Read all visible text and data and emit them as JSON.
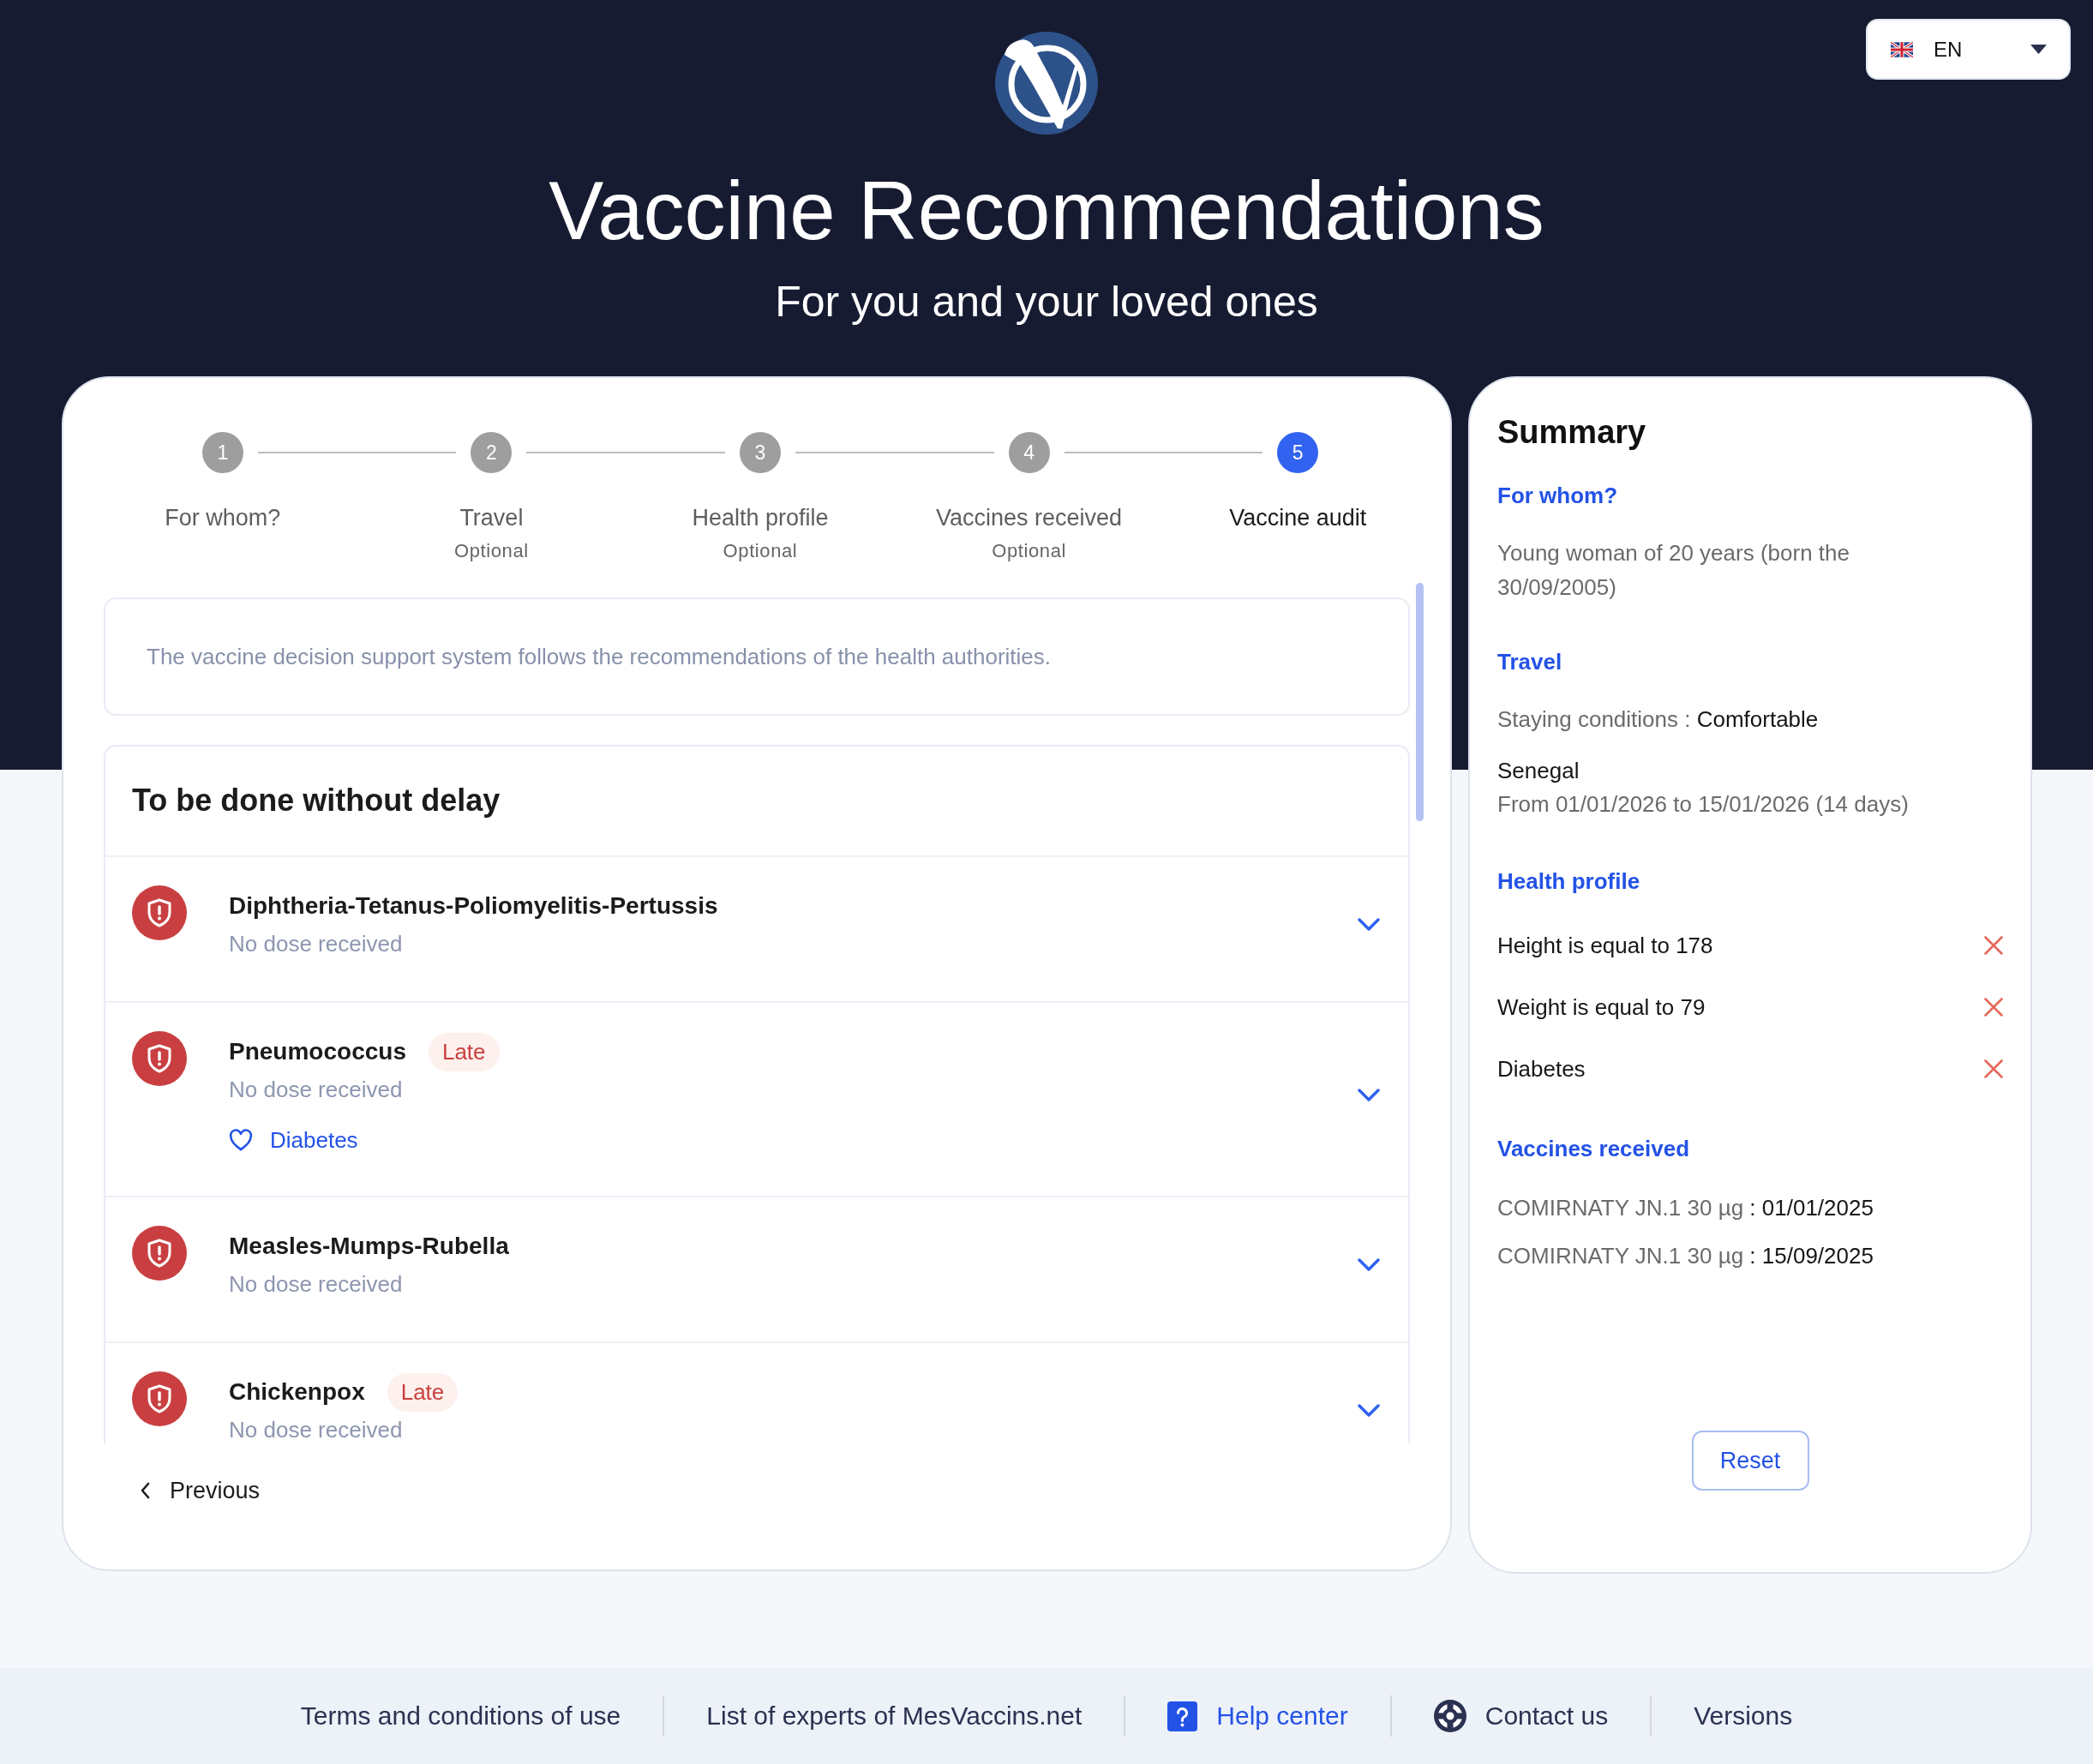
{
  "language_selector": {
    "code": "EN"
  },
  "header": {
    "title": "Vaccine Recommendations",
    "subtitle": "For you and your loved ones"
  },
  "stepper": [
    {
      "number": "1",
      "label": "For whom?",
      "selected": false
    },
    {
      "number": "2",
      "label": "Travel",
      "note": "Optional",
      "selected": false
    },
    {
      "number": "3",
      "label": "Health profile",
      "note": "Optional",
      "selected": false
    },
    {
      "number": "4",
      "label": "Vaccines received",
      "note": "Optional",
      "selected": false
    },
    {
      "number": "5",
      "label": "Vaccine audit",
      "selected": true
    }
  ],
  "notice": "The vaccine decision support system follows the recommendations of the health authorities.",
  "section": {
    "title": "To be done without delay",
    "items": [
      {
        "name": "Diphtheria-Tetanus-Poliomyelitis-Pertussis",
        "status": "No dose received"
      },
      {
        "name": "Pneumococcus",
        "badge": "Late",
        "status": "No dose received",
        "tags": [
          "Diabetes"
        ]
      },
      {
        "name": "Measles-Mumps-Rubella",
        "status": "No dose received"
      },
      {
        "name": "Chickenpox",
        "badge": "Late",
        "status": "No dose received"
      }
    ]
  },
  "previous_button": "Previous",
  "summary": {
    "title": "Summary",
    "for_whom": {
      "heading": "For whom?",
      "text": "Young woman of 20 years (born the 30/09/2005)"
    },
    "travel": {
      "heading": "Travel",
      "staying_label": "Staying conditions :",
      "staying_value": "Comfortable",
      "destination": "Senegal",
      "dates": "From 01/01/2026 to 15/01/2026 (14 days)"
    },
    "health_profile": {
      "heading": "Health profile",
      "items": [
        "Height is equal to 178",
        "Weight is equal to 79",
        "Diabetes"
      ]
    },
    "vaccines_received": {
      "heading": "Vaccines received",
      "items": [
        {
          "vaccine": "COMIRNATY JN.1 30 µg",
          "date": ": 01/01/2025"
        },
        {
          "vaccine": "COMIRNATY JN.1 30 µg",
          "date": ": 15/09/2025"
        }
      ]
    },
    "reset_button": "Reset"
  },
  "footer": {
    "links": [
      {
        "kind": "plain",
        "label": "Terms and conditions of use"
      },
      {
        "kind": "plain",
        "label": "List of experts of MesVaccins.net"
      },
      {
        "kind": "help",
        "label": "Help center"
      },
      {
        "kind": "contact",
        "label": "Contact us"
      },
      {
        "kind": "plain",
        "label": "Versions"
      }
    ]
  }
}
